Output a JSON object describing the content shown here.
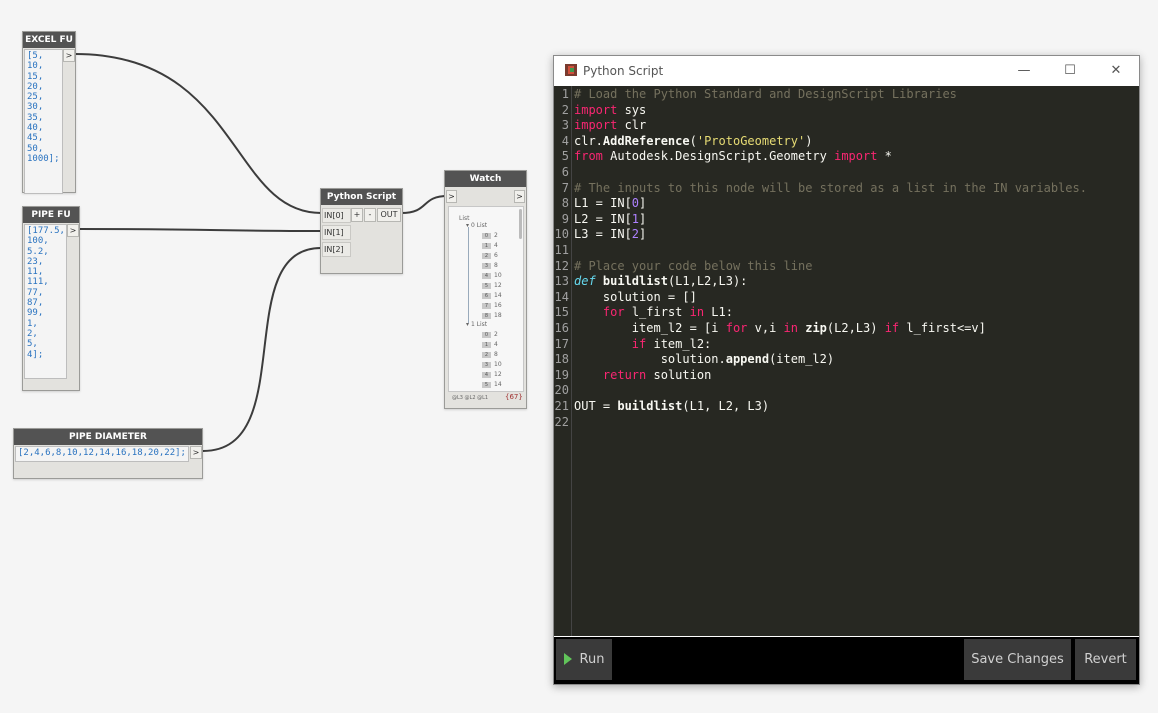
{
  "nodes": {
    "excel_fu": {
      "title": "EXCEL FU",
      "code": "[5,\n10,\n15,\n20,\n25,\n30,\n35,\n40,\n45,\n50,\n1000];",
      "port": ">"
    },
    "pipe_fu": {
      "title": "PIPE FU",
      "code": "[177.5,\n100,\n5.2,\n23,\n11,\n111,\n77,\n87,\n99,\n1,\n2,\n5,\n4];",
      "port": ">"
    },
    "pipe_diameter": {
      "title": "PIPE DIAMETER",
      "code": "[2,4,6,8,10,12,14,16,18,20,22];",
      "port": ">"
    },
    "python_script": {
      "title": "Python Script",
      "in0": "IN[0]",
      "in1": "IN[1]",
      "in2": "IN[2]",
      "plus": "+",
      "minus": "-",
      "out": "OUT"
    },
    "watch": {
      "title": "Watch",
      "in_port": ">",
      "out_port": ">",
      "root": "List",
      "sub0": "0 List",
      "sub1": "1 List",
      "list0": [
        [
          "0",
          "2"
        ],
        [
          "1",
          "4"
        ],
        [
          "2",
          "6"
        ],
        [
          "3",
          "8"
        ],
        [
          "4",
          "10"
        ],
        [
          "5",
          "12"
        ],
        [
          "6",
          "14"
        ],
        [
          "7",
          "16"
        ],
        [
          "8",
          "18"
        ]
      ],
      "list1": [
        [
          "0",
          "2"
        ],
        [
          "1",
          "4"
        ],
        [
          "2",
          "8"
        ],
        [
          "3",
          "10"
        ],
        [
          "4",
          "12"
        ],
        [
          "5",
          "14"
        ]
      ],
      "footer_levels": "@L3 @L2 @L1",
      "footer_count": "{67}"
    }
  },
  "editor": {
    "window_title": "Python Script",
    "controls": {
      "minimize": "—",
      "maximize": "☐",
      "close": "✕"
    },
    "line_numbers": [
      "1",
      "2",
      "3",
      "4",
      "5",
      "6",
      "7",
      "8",
      "9",
      "10",
      "11",
      "12",
      "13",
      "14",
      "15",
      "16",
      "17",
      "18",
      "19",
      "20",
      "21",
      "22"
    ],
    "code": {
      "l1": "# Load the Python Standard and DesignScript Libraries",
      "l2_kw": "import",
      "l2_rest": " sys",
      "l3_kw": "import",
      "l3_rest": " clr",
      "l4_a": "clr.",
      "l4_fn": "AddReference",
      "l4_b": "(",
      "l4_str": "'ProtoGeometry'",
      "l4_c": ")",
      "l5_kw1": "from",
      "l5_mid": " Autodesk.DesignScript.Geometry ",
      "l5_kw2": "import",
      "l5_rest": " *",
      "l7": "# The inputs to this node will be stored as a list in the IN variables.",
      "l8_a": "L1 = IN[",
      "l8_n": "0",
      "l8_b": "]",
      "l9_a": "L2 = IN[",
      "l9_n": "1",
      "l9_b": "]",
      "l10_a": "L3 = IN[",
      "l10_n": "2",
      "l10_b": "]",
      "l12": "# Place your code below this line",
      "l13_kw": "def",
      "l13_fn": " buildlist",
      "l13_rest": "(L1,L2,L3):",
      "l14": "    solution = []",
      "l15_ind": "    ",
      "l15_kw": "for",
      "l15_mid": " l_first ",
      "l15_kw2": "in",
      "l15_rest": " L1:",
      "l16_a": "        item_l2 = [i ",
      "l16_kw1": "for",
      "l16_b": " v,i ",
      "l16_kw2": "in",
      "l16_c": " ",
      "l16_fn": "zip",
      "l16_d": "(L2,L3) ",
      "l16_kw3": "if",
      "l16_e": " l_first<=v]",
      "l17_ind": "        ",
      "l17_kw": "if",
      "l17_rest": " item_l2:",
      "l18_a": "            solution.",
      "l18_fn": "append",
      "l18_b": "(item_l2)",
      "l19_ind": "    ",
      "l19_kw": "return",
      "l19_rest": " solution",
      "l21_a": "OUT = ",
      "l21_fn": "buildlist",
      "l21_b": "(L1, L2, L3)"
    },
    "buttons": {
      "run": "Run",
      "save": "Save Changes",
      "revert": "Revert"
    }
  },
  "colors": {
    "editor_bg": "#272822",
    "comment": "#75715e",
    "keyword": "#f92672",
    "string": "#e6db74",
    "number": "#ae81ff",
    "def": "#66d9ef",
    "run_icon": "#61c45a",
    "node_header": "#535353",
    "wire": "#333333"
  }
}
